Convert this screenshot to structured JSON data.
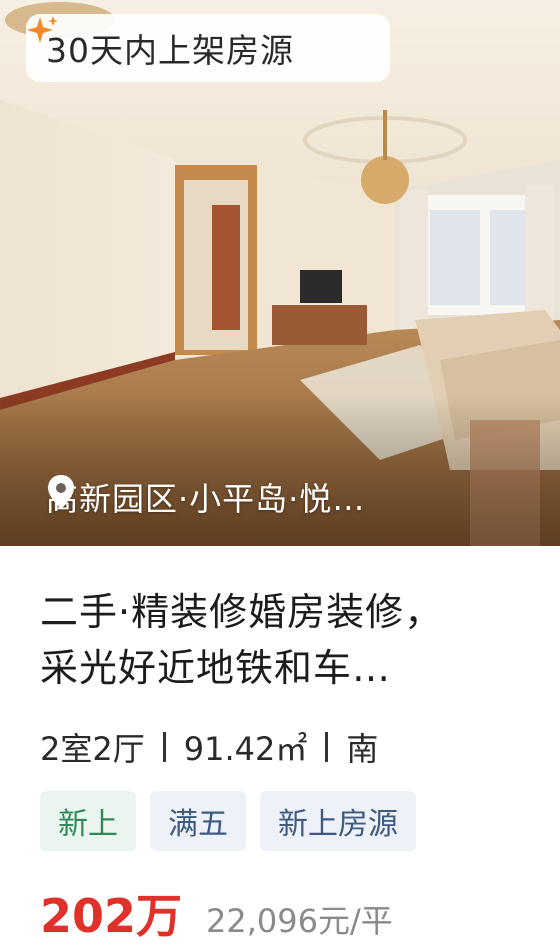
{
  "listing": {
    "badge": {
      "text": "30天内上架房源",
      "icon": "sparkle-icon"
    },
    "location": {
      "text": "高新园区·小平岛·悦…",
      "icon": "location-pin-icon"
    },
    "title_line1": "二手·精装修婚房装修，",
    "title_line2": "采光好近地铁和车…",
    "specs": {
      "layout": "2室2厅",
      "area": "91.42㎡",
      "orientation": "南"
    },
    "tags": [
      {
        "label": "新上",
        "style": "green"
      },
      {
        "label": "满五",
        "style": "blue"
      },
      {
        "label": "新上房源",
        "style": "blue"
      }
    ],
    "price": "202万",
    "unit_price": "22,096元/平"
  },
  "colors": {
    "price": "#e0302a",
    "tag_green": "#2f8a57",
    "tag_blue": "#3f5a80"
  }
}
